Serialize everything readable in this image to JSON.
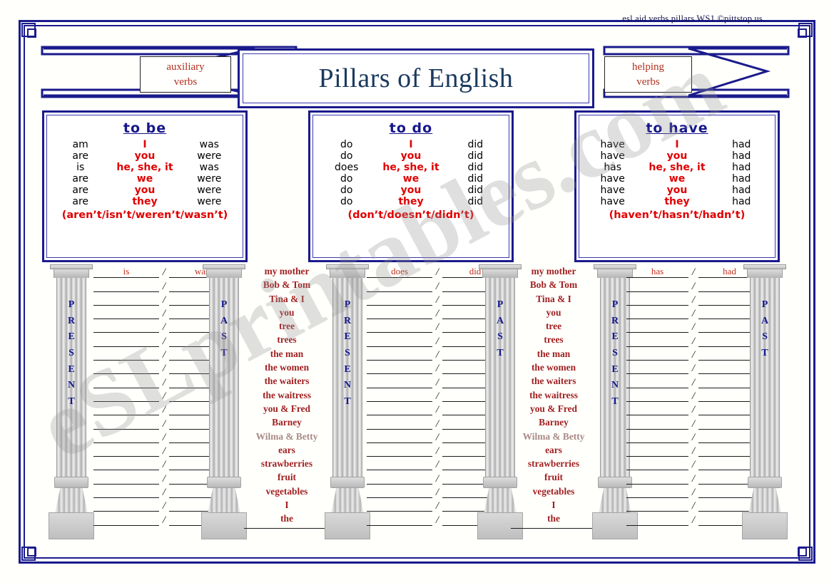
{
  "document": {
    "credit": "esl aid verbs pillars WS1  ©pittstop.us",
    "title": "Pillars of English",
    "watermark": "eSLprintables.com"
  },
  "banners": {
    "left_label_line1": "auxiliary",
    "left_label_line2": "verbs",
    "right_label_line1": "helping",
    "right_label_line2": "verbs"
  },
  "colors": {
    "frame_blue": "#1a1a8c",
    "title_navy": "#1b3a5e",
    "pronoun_red": "#e00000",
    "wordlist_red": "#9f1f1f",
    "hint_red": "#c03020",
    "pillar_gray": "#c9c9c9"
  },
  "verb_panels": [
    {
      "title": "to be",
      "rows": [
        {
          "present": "am",
          "pronoun": "I",
          "past": "was"
        },
        {
          "present": "are",
          "pronoun": "you",
          "past": "were"
        },
        {
          "present": "is",
          "pronoun": "he, she, it",
          "past": "was"
        },
        {
          "present": "are",
          "pronoun": "we",
          "past": "were"
        },
        {
          "present": "are",
          "pronoun": "you",
          "past": "were"
        },
        {
          "present": "are",
          "pronoun": "they",
          "past": "were"
        }
      ],
      "negatives": "(aren’t/isn’t/weren’t/wasn’t)"
    },
    {
      "title": "to do",
      "rows": [
        {
          "present": "do",
          "pronoun": "I",
          "past": "did"
        },
        {
          "present": "do",
          "pronoun": "you",
          "past": "did"
        },
        {
          "present": "does",
          "pronoun": "he, she, it",
          "past": "did"
        },
        {
          "present": "do",
          "pronoun": "we",
          "past": "did"
        },
        {
          "present": "do",
          "pronoun": "you",
          "past": "did"
        },
        {
          "present": "do",
          "pronoun": "they",
          "past": "did"
        }
      ],
      "negatives": "(don’t/doesn’t/didn’t)"
    },
    {
      "title": "to have",
      "rows": [
        {
          "present": "have",
          "pronoun": "I",
          "past": "had"
        },
        {
          "present": "have",
          "pronoun": "you",
          "past": "had"
        },
        {
          "present": "has",
          "pronoun": "he, she, it",
          "past": "had"
        },
        {
          "present": "have",
          "pronoun": "we",
          "past": "had"
        },
        {
          "present": "have",
          "pronoun": "you",
          "past": "had"
        },
        {
          "present": "have",
          "pronoun": "they",
          "past": "had"
        }
      ],
      "negatives": "(haven’t/hasn’t/hadn’t)"
    }
  ],
  "pillar_labels": {
    "present": [
      "P",
      "R",
      "E",
      "S",
      "E",
      "N",
      "T"
    ],
    "past": [
      "P",
      "A",
      "S",
      "T"
    ]
  },
  "exercises": [
    {
      "present_hint": "is",
      "past_hint": "was",
      "separator": "/",
      "line_count": 19
    },
    {
      "present_hint": "does",
      "past_hint": "did",
      "separator": "/",
      "line_count": 19
    },
    {
      "present_hint": "has",
      "past_hint": "had",
      "separator": "/",
      "line_count": 19
    }
  ],
  "subject_words": [
    "my mother",
    "Bob & Tom",
    "Tina & I",
    "you",
    "tree",
    "trees",
    "the man",
    "the women",
    "the waiters",
    "the waitress",
    "you & Fred",
    "Barney",
    "Wilma & Betty",
    "ears",
    "strawberries",
    "fruit",
    "vegetables",
    "I",
    "the"
  ]
}
